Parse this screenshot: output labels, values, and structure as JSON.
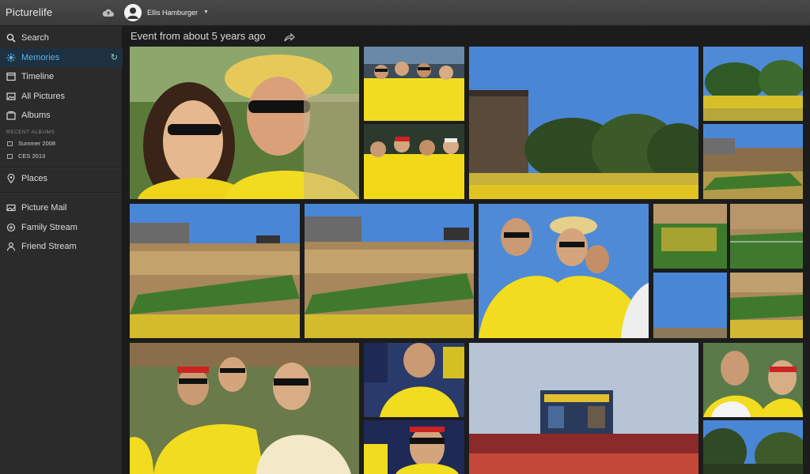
{
  "app": {
    "brand": "Picturelife",
    "user_name": "Ellis Hamburger"
  },
  "sidebar": {
    "search": "Search",
    "memories": "Memories",
    "timeline": "Timeline",
    "all_pictures": "All Pictures",
    "albums": "Albums",
    "recent_albums_label": "RECENT ALBUMS",
    "recent_albums": [
      "Summer 2008",
      "CES 2013"
    ],
    "places": "Places",
    "picture_mail": "Picture Mail",
    "family_stream": "Family Stream",
    "friend_stream": "Friend Stream"
  },
  "main": {
    "event_title": "Event from about 5 years ago"
  },
  "colors": {
    "accent": "#5ab3f0",
    "active_bg": "#1d3140",
    "maize": "#f2dc1f",
    "grass": "#3f7a2c",
    "sky": "#4a86d6"
  },
  "icons": [
    "cloud-icon",
    "avatar-icon",
    "search-icon",
    "memories-icon",
    "refresh-icon",
    "timeline-icon",
    "all-pictures-icon",
    "albums-icon",
    "places-icon",
    "picture-mail-icon",
    "family-stream-icon",
    "friend-stream-icon",
    "share-icon"
  ]
}
